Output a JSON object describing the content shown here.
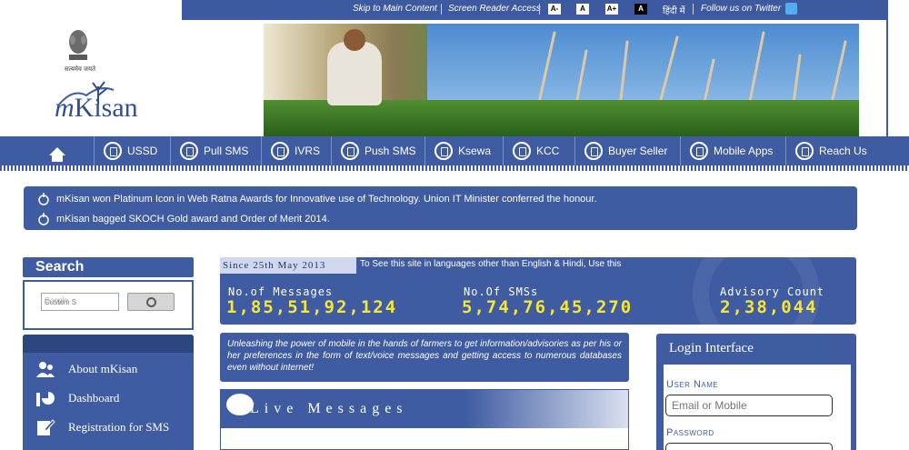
{
  "top_links": {
    "skip": "Skip to Main Content",
    "reader": "Screen Reader Access",
    "font_minus": "A-",
    "font_normal": "A",
    "font_plus": "A+",
    "contrast": "A",
    "hindi": "हिंदी में",
    "twitter": "Follow us on Twitter"
  },
  "header": {
    "logo_text": "Kisan",
    "logo_m": "m",
    "emblem_motto": "सत्यमेव जयते"
  },
  "nav": {
    "items": [
      {
        "label": "USSD",
        "icon": "phone-icon"
      },
      {
        "label": "Pull SMS",
        "icon": "phone-icon"
      },
      {
        "label": "IVRS",
        "icon": "phone-icon"
      },
      {
        "label": "Push SMS",
        "icon": "mail-icon"
      },
      {
        "label": "Ksewa",
        "icon": "service-icon"
      },
      {
        "label": "KCC",
        "icon": "call-center-icon"
      },
      {
        "label": "Buyer Seller",
        "icon": "handshake-icon"
      },
      {
        "label": "Mobile Apps",
        "icon": "android-icon"
      },
      {
        "label": "Reach Us",
        "icon": "telephone-icon"
      }
    ]
  },
  "news": [
    "mKisan won Platinum Icon in Web Ratna Awards for Innovative use of Technology. Union IT Minister conferred the honour.",
    "mKisan bagged SKOCH Gold award and Order of Merit 2014."
  ],
  "search": {
    "title": "Search",
    "placeholder": "Custom S",
    "brand": "Google"
  },
  "left_menu": [
    {
      "label": "About mKisan",
      "icon": "users-icon"
    },
    {
      "label": "Dashboard",
      "icon": "chart-icon"
    },
    {
      "label": "Registration for SMS",
      "icon": "edit-icon"
    }
  ],
  "counter": {
    "since": "Since 25th May 2013",
    "lang_note": "To See this site in languages other than English & Hindi, Use this",
    "messages_label": "No.of Messages",
    "messages_value": "1,85,51,92,124",
    "sms_label": "No.Of SMSs",
    "sms_value": "5,74,76,45,270",
    "advisory_label": "Advisory Count",
    "advisory_value": "2,38,044"
  },
  "tagline": "Unleashing the power of mobile in the hands of farmers to get information/advisories as per his or her preferences in the form of text/voice messages and getting access to numerous databases even without internet!",
  "live": {
    "title": "Live Messages"
  },
  "login": {
    "title": "Login Interface",
    "user_label": "User Name",
    "user_placeholder": "Email or Mobile",
    "pass_label": "Password"
  },
  "colors": {
    "primary": "#3f5ca2",
    "counter_digits": "#f5e63a",
    "twitter": "#55acee"
  }
}
